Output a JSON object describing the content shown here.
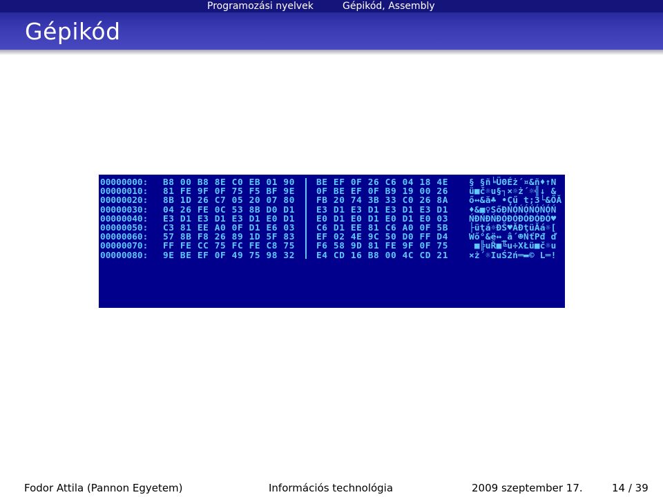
{
  "header": {
    "section": "Programozási nyelvek",
    "subsection": "Gépikód, Assembly",
    "frame_title": "Gépikód"
  },
  "dump": {
    "rows": [
      {
        "addr": "00000000:",
        "hex1": "B8 00 B8 8E C0 EB 01 90",
        "hex2": "BE EF 0F 26 C6 04 18 4E",
        "ascii": "§ §ñ╘ÜΘÉż´¤&ñ♦↑N"
      },
      {
        "addr": "00000010:",
        "hex1": "81 FE 9F 0F 75 F5 BF 9E",
        "hex2": "0F BE EF 0F B9 19 00 26",
        "ascii": "ü■č☼u§┐×☼ż´☼╣↓ &"
      },
      {
        "addr": "00000020:",
        "hex1": "8B 1D 26 C7 05 20 07 80",
        "hex2": "FB 20 74 3B 33 C0 26 8A",
        "ascii": "ő↔&ă♣ •Çű t;3└&ŐĂ"
      },
      {
        "addr": "00000030:",
        "hex1": "04 26 FE 0C 53 8B D0 D1",
        "hex2": "E3 D1 E3 D1 E3 D1 E3 D1",
        "ascii": "♦&■♀SőĐŃÓŃÓŃÓŃÓŃ"
      },
      {
        "addr": "00000040:",
        "hex1": "E3 D1 E3 D1 E3 D1 E0 D1",
        "hex2": "E0 D1 E0 D1 E0 D1 E0 03",
        "ascii": "ŃĐŃĐŃĐÓĐÓĐÓĐÓĐÓ♥"
      },
      {
        "addr": "00000050:",
        "hex1": "C3 81 EE A0 0F D1 E6 03",
        "hex2": "C6 D1 EE 81 C6 A0 0F 5B",
        "ascii": "├üţá☼ĐŠ♥ĂĐţüĂá☼["
      },
      {
        "addr": "00000060:",
        "hex1": "57 8B F8 26 89 1D 5F 83",
        "hex2": "EF 02 4E 9C 50 D0 FF D4",
        "ascii": "Wő°&ë↔_â´☻NťPđ ď"
      },
      {
        "addr": "00000070:",
        "hex1": "FF FE CC 75 FC FE C8 75",
        "hex2": "F6 58 9D 81 FE 9F 0F 75",
        "ascii": " ■╠uŘ■╚u÷XŁü■č☼u"
      },
      {
        "addr": "00000080:",
        "hex1": "9E BE EF 0F 49 75 98 32",
        "hex2": "E4 CD 16 B8 00 4C CD 21",
        "ascii": "×ż´☼IuŚ2ń═▬© L═!"
      }
    ]
  },
  "footer": {
    "author": "Fodor Attila  (Pannon Egyetem)",
    "title": "Információs technológia",
    "date": "2009 szeptember 17.",
    "page": "14 / 39"
  }
}
